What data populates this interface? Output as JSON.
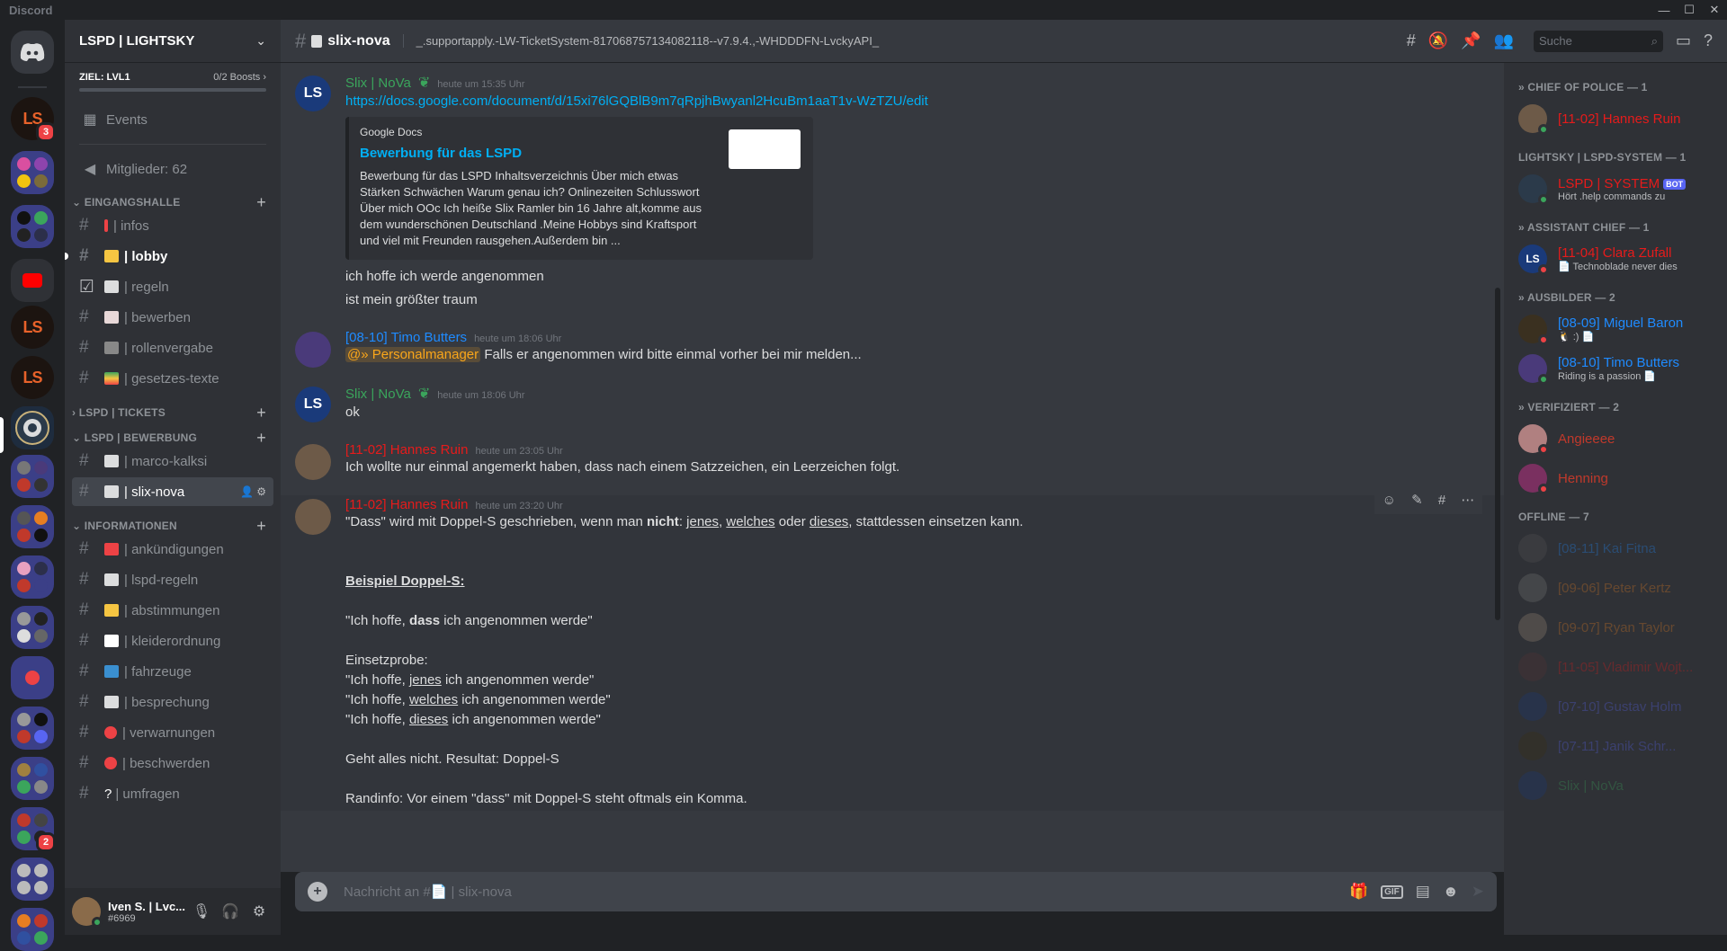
{
  "window": {
    "title": "Discord",
    "controls": [
      "—",
      "☐",
      "✕"
    ]
  },
  "rail": {
    "servers": [
      {
        "name": "home"
      },
      {
        "label": "LS",
        "badge": "3"
      },
      {
        "name": "folder-1"
      },
      {
        "name": "folder-2"
      },
      {
        "name": "youtube"
      },
      {
        "label": "LS"
      },
      {
        "label": "LS"
      },
      {
        "name": "seal"
      },
      {
        "name": "folder-3"
      },
      {
        "name": "folder-4"
      },
      {
        "name": "folder-5"
      },
      {
        "name": "folder-6"
      },
      {
        "name": "folder-7"
      },
      {
        "name": "folder-8"
      },
      {
        "name": "folder-9"
      },
      {
        "name": "folder-10",
        "badge": "2"
      },
      {
        "name": "folder-11"
      },
      {
        "name": "folder-12"
      }
    ]
  },
  "guild": {
    "name": "LSPD | LIGHTSKY",
    "boost_goal": "ZIEL: LVL1",
    "boost_count": "0/2 Boosts",
    "events": "Events",
    "members_count": "Mitglieder: 62",
    "categories": [
      {
        "name": "EINGANGSHALLE",
        "channels": [
          {
            "name": "| infos",
            "emoji": "!"
          },
          {
            "name": "| lobby",
            "emoji": "👋",
            "unread": true
          },
          {
            "name": "| regeln",
            "emoji": "📄"
          },
          {
            "name": "| bewerben",
            "emoji": "📝"
          },
          {
            "name": "| rollenvergabe",
            "emoji": "💻"
          },
          {
            "name": "| gesetzes-texte",
            "emoji": "📚"
          }
        ]
      },
      {
        "name": "LSPD | TICKETS",
        "channels": []
      },
      {
        "name": "LSPD | BEWERBUNG",
        "channels": [
          {
            "name": "| marco-kalksi",
            "emoji": "📄"
          },
          {
            "name": "| slix-nova",
            "emoji": "📄",
            "active": true
          }
        ]
      },
      {
        "name": "INFORMATIONEN",
        "channels": [
          {
            "name": "| ankündigungen",
            "emoji": "📢"
          },
          {
            "name": "| lspd-regeln",
            "emoji": "📄"
          },
          {
            "name": "| abstimmungen",
            "emoji": "👉"
          },
          {
            "name": "| kleiderordnung",
            "emoji": "👕"
          },
          {
            "name": "| fahrzeuge",
            "emoji": "🚗"
          },
          {
            "name": "| besprechung",
            "emoji": "🔊"
          },
          {
            "name": "| verwarnungen",
            "emoji": "🚫"
          },
          {
            "name": "| beschwerden",
            "emoji": "🚫"
          },
          {
            "name": "| umfragen",
            "emoji": "?"
          }
        ]
      }
    ]
  },
  "user": {
    "name": "Iven S. | Lvc...",
    "tag": "#6969"
  },
  "channel": {
    "name": "slix-nova",
    "topic": "_.supportapply.-LW-TicketSystem-817068757134082118--v7.9.4.,-WHDDDFN-LvckyAPI_",
    "search_placeholder": "Suche"
  },
  "messages": [
    {
      "author": "Slix | NoVa",
      "author_color": "#3ba55c",
      "time": "heute um 15:35 Uhr",
      "avatar": "LS",
      "link": "https://docs.google.com/document/d/15xi76lGQBlB9m7qRpjhBwyanl2HcuBm1aaT1v-WzTZU/edit",
      "embed": {
        "provider": "Google Docs",
        "title": "Bewerbung für das LSPD",
        "description": "Bewerbung für das LSPD Inhaltsverzeichnis Über mich etwas Stärken Schwächen Warum genau ich? Onlinezeiten Schlusswort Über mich OOc Ich heiße Slix Ramler bin 16 Jahre alt,komme aus dem wunderschönen Deutschland .Meine Hobbys sind Kraftsport und viel mit Freunden rausgehen.Außerdem bin ..."
      },
      "lines": [
        "ich hoffe ich werde angenommen",
        "ist mein größter traum"
      ]
    },
    {
      "author": "[08-10] Timo Butters",
      "author_color": "#1f8bff",
      "time": "heute um 18:06 Uhr",
      "mention": "@» Personalmanager",
      "text": "Falls er angenommen wird bitte einmal vorher bei mir melden..."
    },
    {
      "author": "Slix | NoVa",
      "author_color": "#3ba55c",
      "time": "heute um 18:06 Uhr",
      "avatar": "LS",
      "text": "ok"
    },
    {
      "author": "[11-02] Hannes Ruin",
      "author_color": "#e61b1b",
      "time": "heute um 23:05 Uhr",
      "text": "Ich wollte nur einmal angemerkt haben, dass nach einem Satzzeichen, ein Leerzeichen folgt."
    },
    {
      "author": "[11-02] Hannes Ruin",
      "author_color": "#e61b1b",
      "time": "heute um 23:20 Uhr",
      "intro_a": "\"Dass\" wird mit Doppel-S geschrieben, wenn man ",
      "intro_bold": "nicht",
      "intro_b": ": ",
      "w1": "jenes",
      "sep1": ", ",
      "w2": "welches",
      "sep2": " oder ",
      "w3": "dieses",
      "intro_c": ", stattdessen einsetzen kann.",
      "heading": "Beispiel Doppel-S:",
      "ex_a": "\"Ich hoffe, ",
      "ex_bold": "dass",
      "ex_b": " ich angenommen werde\"",
      "probe": "Einsetzprobe:",
      "p_pre": "\"Ich hoffe, ",
      "p_post": " ich angenommen werde\"",
      "result": "Geht alles nicht. Resultat: Doppel-S",
      "note": "Randinfo: Vor einem \"dass\" mit Doppel-S steht oftmals ein Komma."
    }
  ],
  "composer": {
    "placeholder": "Nachricht an #📄 | slix-nova",
    "gif": "GIF"
  },
  "members": [
    {
      "category": "» CHIEF OF POLICE — 1",
      "items": [
        {
          "name": "[11-02] Hannes Ruin",
          "color": "#e61b1b",
          "status": "#3ba55c",
          "avatar": "#6d5a48"
        }
      ]
    },
    {
      "category": "LIGHTSKY | LSPD-SYSTEM — 1",
      "items": [
        {
          "name": "LSPD | SYSTEM",
          "color": "#e61b1b",
          "status": "#3ba55c",
          "bot": "BOT",
          "sub": "Hört .help commands zu",
          "avatar": "#2b3a4a"
        }
      ]
    },
    {
      "category": "» ASSISTANT CHIEF — 1",
      "items": [
        {
          "name": "[11-04] Clara Zufall",
          "color": "#e61b1b",
          "status": "#ed4245",
          "sub": "📄 Technoblade never dies",
          "avatar": "#1a3a7a",
          "ls": true
        }
      ]
    },
    {
      "category": "» AUSBILDER — 2",
      "items": [
        {
          "name": "[08-09] Miguel Baron",
          "color": "#1f8bff",
          "status": "#ed4245",
          "sub": "🐧 :) 📄",
          "avatar": "#3a3020"
        },
        {
          "name": "[08-10] Timo Butters",
          "color": "#1f8bff",
          "status": "#3ba55c",
          "sub": "Riding is a passion 📄",
          "avatar": "#4a3a7a"
        }
      ]
    },
    {
      "category": "» VERIFIZIERT — 2",
      "items": [
        {
          "name": "Angieeee",
          "color": "#c0392b",
          "status": "#ed4245",
          "avatar": "#b08080"
        },
        {
          "name": "Henning",
          "color": "#c0392b",
          "status": "#ed4245",
          "avatar": "#7a3060"
        }
      ]
    },
    {
      "category": "OFFLINE — 7",
      "offline": true,
      "items": [
        {
          "name": "[08-11] Kai Fitna",
          "color": "#1f8bff",
          "avatar": "#555"
        },
        {
          "name": "[09-06] Peter Kertz",
          "color": "#e67e22",
          "avatar": "#777"
        },
        {
          "name": "[09-07] Ryan Taylor",
          "color": "#e67e22",
          "avatar": "#998877"
        },
        {
          "name": "[11-05] Vladimir Wojt...",
          "color": "#e61b1b",
          "avatar": "#553333"
        },
        {
          "name": "[07-10] Gustav Holm",
          "color": "#5865f2",
          "avatar": "#1a3a7a",
          "ls": true
        },
        {
          "name": "[07-11] Janik Schr...",
          "color": "#5865f2",
          "avatar": "#3a3010",
          "ls": true
        },
        {
          "name": "Slix | NoVa",
          "color": "#3ba55c",
          "avatar": "#1a3a7a",
          "ls": true
        }
      ]
    }
  ]
}
